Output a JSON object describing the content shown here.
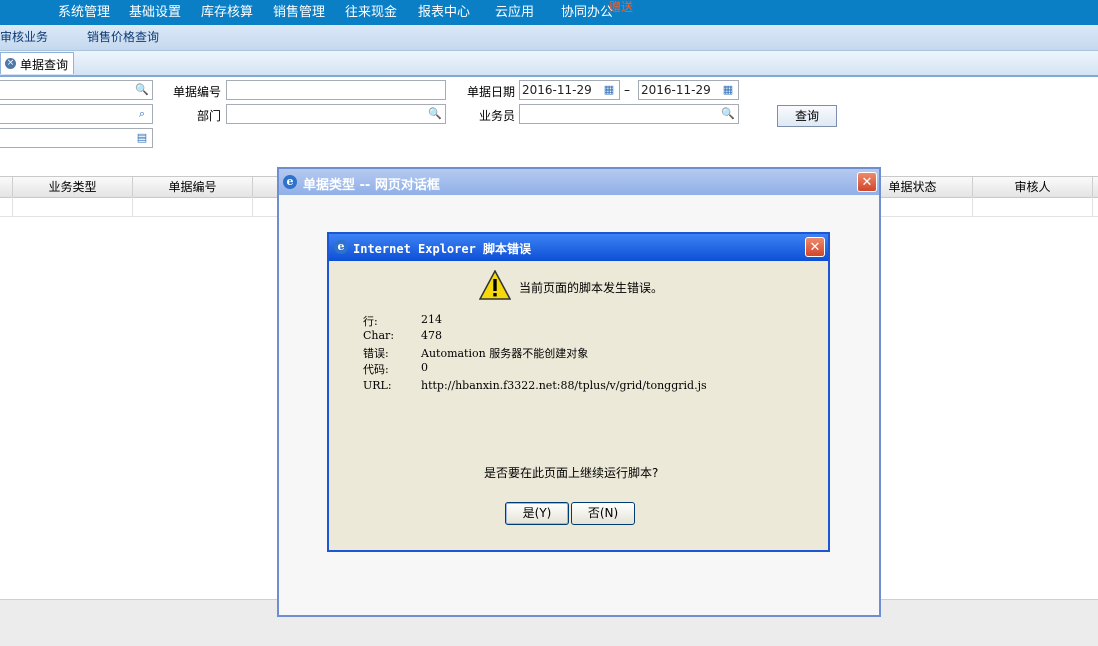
{
  "top_menu": {
    "items": [
      "系统管理",
      "基础设置",
      "库存核算",
      "销售管理",
      "往来现金",
      "报表中心",
      "云应用",
      "协同办公"
    ],
    "badge": "赠送"
  },
  "sub_menu": {
    "items": [
      "待审核业务",
      "销售价格查询"
    ]
  },
  "tab": {
    "label": "单据查询"
  },
  "form": {
    "doc_no_label": "单据编号",
    "doc_date_label": "单据日期",
    "date_from": "2016-11-29",
    "date_to": "2016-11-29",
    "date_sep": "–",
    "dept_label": "部门",
    "salesman_label": "业务员",
    "query_button": "查询"
  },
  "grid": {
    "headers": [
      "业务类型",
      "单据编号",
      "单据状态",
      "审核人"
    ]
  },
  "outer_dialog": {
    "title": "单据类型 -- 网页对话框"
  },
  "error_dialog": {
    "title": "Internet Explorer 脚本错误",
    "message": "当前页面的脚本发生错误。",
    "fields": [
      {
        "key": "行:",
        "value": "214"
      },
      {
        "key": "Char:",
        "value": "478"
      },
      {
        "key": "错误:",
        "value": "Automation 服务器不能创建对象"
      },
      {
        "key": "代码:",
        "value": "0"
      },
      {
        "key": "URL:",
        "value": "http://hbanxin.f3322.net:88/tplus/v/grid/tonggrid.js"
      }
    ],
    "question": "是否要在此页面上继续运行脚本?",
    "yes_button": "是(Y)",
    "no_button": "否(N)"
  },
  "colors": {
    "menu_bg": "#0a7fc6",
    "dialog_title": "#0c4fd6",
    "close_red": "#d1462a"
  }
}
